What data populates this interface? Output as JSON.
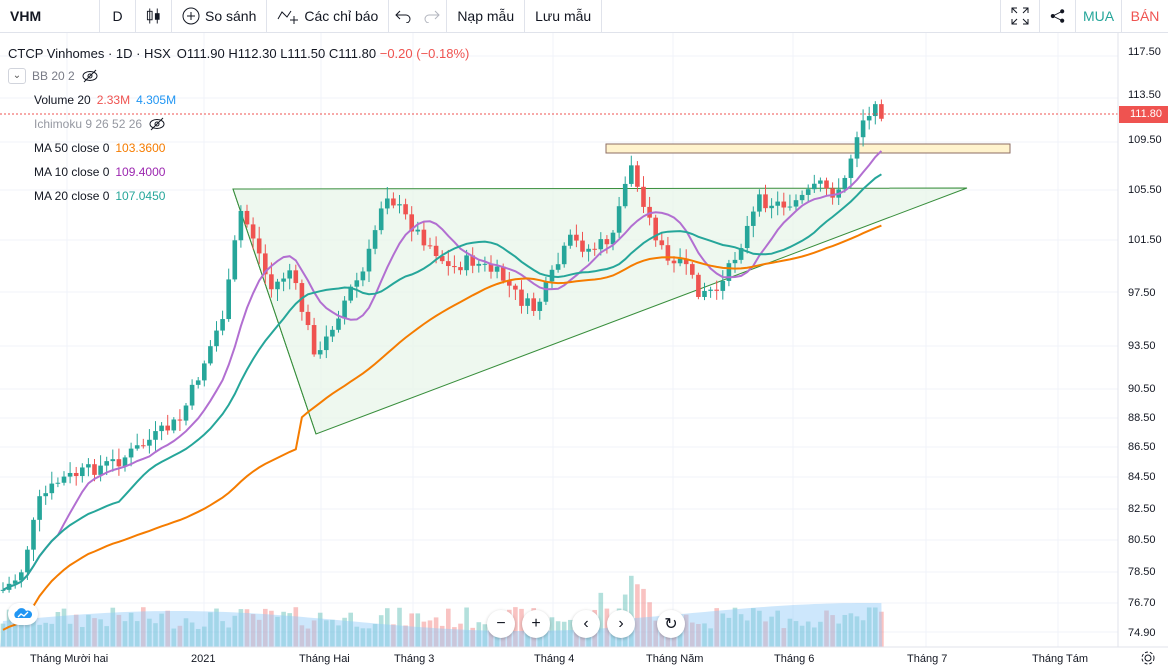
{
  "toolbar": {
    "symbol": "VHM",
    "interval": "D",
    "compare_label": "So sánh",
    "indicators_label": "Các chỉ báo",
    "load_template_label": "Nạp mẫu",
    "save_template_label": "Lưu mẫu",
    "buy_label": "MUA",
    "sell_label": "BÁN"
  },
  "legend": {
    "title": "CTCP Vinhomes · 1D · HSX",
    "open": "O111.90",
    "high": "H112.30",
    "low": "L111.50",
    "close": "C111.80",
    "change": "−0.20 (−0.18%)",
    "bb": "BB 20 2",
    "volume_label": "Volume 20",
    "volume_v1": "2.33M",
    "volume_v2": "4.305M",
    "ichimoku": "Ichimoku 9 26 52 26",
    "ma50_label": "MA 50 close 0",
    "ma50_value": "103.3600",
    "ma10_label": "MA 10 close 0",
    "ma10_value": "109.4000",
    "ma20_label": "MA 20 close 0",
    "ma20_value": "107.0450"
  },
  "price_axis": [
    "117.50",
    "113.50",
    "109.50",
    "105.50",
    "101.50",
    "97.50",
    "93.50",
    "90.50",
    "88.50",
    "86.50",
    "84.50",
    "82.50",
    "80.50",
    "78.50",
    "76.70",
    "74.90"
  ],
  "last_price": "111.80",
  "time_axis": [
    "Tháng Mười hai",
    "2021",
    "Tháng Hai",
    "Tháng 3",
    "Tháng 4",
    "Tháng Năm",
    "Tháng 6",
    "Tháng 7",
    "Tháng Tám"
  ],
  "colors": {
    "up": "#26a69a",
    "down": "#ef5350",
    "ma10": "#b26fd1",
    "ma20": "#26a69a",
    "ma50": "#f57c00",
    "volume_ma": "#90caf9"
  },
  "icons": [
    "candles-icon",
    "add-compare-icon",
    "indicators-icon",
    "undo-icon",
    "redo-icon",
    "fullscreen-icon",
    "share-icon",
    "settings-icon",
    "zoom-out-icon",
    "zoom-in-icon",
    "scroll-left-icon",
    "scroll-right-icon",
    "reset-icon",
    "eye-off-icon",
    "tradingview-logo-icon"
  ]
}
